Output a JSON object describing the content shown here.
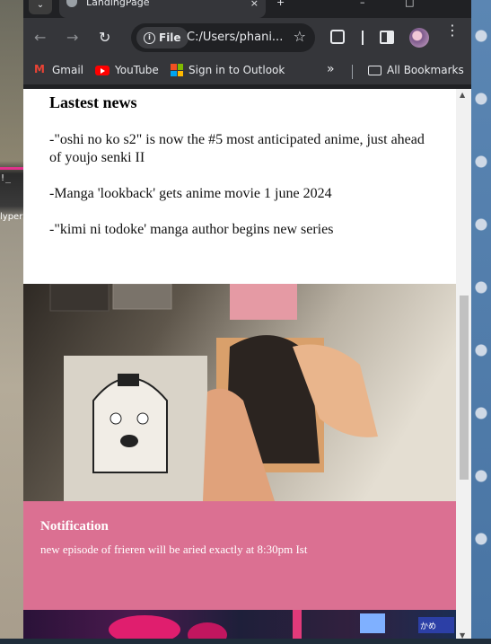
{
  "browser": {
    "tab_title": "LandingPage",
    "tab_close": "×",
    "window_controls": [
      "–",
      "□"
    ],
    "nav": {
      "back": "←",
      "forward": "→",
      "reload": "↻"
    },
    "omnibox": {
      "scheme_label": "File",
      "url": "C:/Users/phani...",
      "star": "☆"
    },
    "menu": "⋮"
  },
  "bookmarks": {
    "items": [
      {
        "label": "Gmail",
        "icon": "gmail-icon"
      },
      {
        "label": "YouTube",
        "icon": "youtube-icon"
      },
      {
        "label": "Sign in to Outlook",
        "icon": "microsoft-icon"
      }
    ],
    "overflow": "»",
    "all_bookmarks": "All Bookmarks"
  },
  "desktop": {
    "left_fragment_1": "!_",
    "left_fragment_2": "lyper"
  },
  "news": {
    "heading": "Lastest news",
    "items": [
      "-\"oshi no ko s2\" is now the #5 most anticipated anime, just ahead of youjo senki II",
      "-Manga 'lookback' gets anime movie 1 june 2024",
      "-\"kimi ni todoke' manga author begins new series"
    ]
  },
  "hero": {
    "description": "hands attaching an anime character photo to a wall"
  },
  "notification": {
    "title": "Notification",
    "text": "new episode of frieren will be aried exactly at 8:30pm Ist",
    "background": "#db7092"
  },
  "bottom_banner": {
    "sign_text": "かめ"
  }
}
